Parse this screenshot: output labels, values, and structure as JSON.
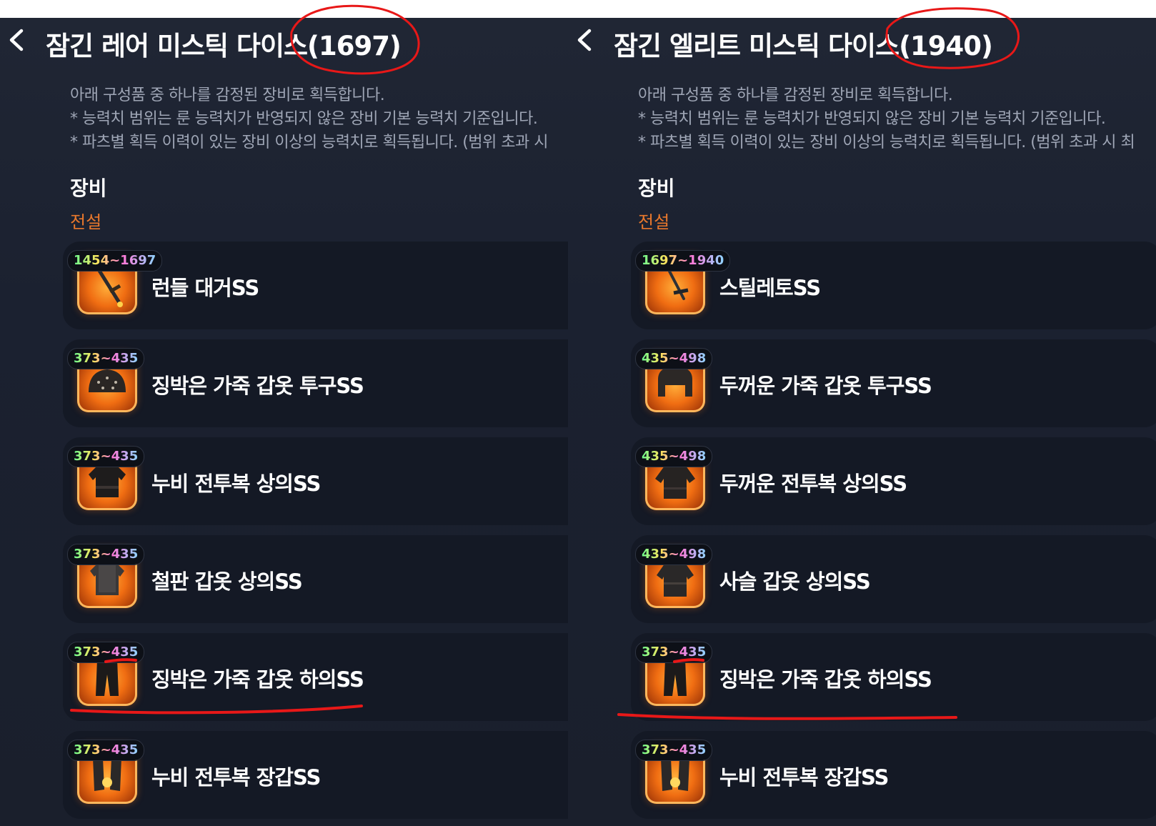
{
  "panels": [
    {
      "title": "잠긴 레어 미스틱 다이스(1697)",
      "description": [
        "아래 구성품 중 하나를 감정된 장비로 획득합니다.",
        "* 능력치 범위는 룬 능력치가 반영되지 않은 장비 기본 능력치 기준입니다.",
        "* 파츠별 획득 이력이 있는 장비 이상의 능력치로 획득됩니다. (범위 초과 시"
      ],
      "section": "장비",
      "tier": "전설",
      "items": [
        {
          "range": "1454~1697",
          "name": "런들 대거SS",
          "icon": "dagger-icon"
        },
        {
          "range": "373~435",
          "name": "징박은 가죽 갑옷 투구SS",
          "icon": "helmet-icon"
        },
        {
          "range": "373~435",
          "name": "누비 전투복 상의SS",
          "icon": "armor-top-icon"
        },
        {
          "range": "373~435",
          "name": "철판 갑옷 상의SS",
          "icon": "armor-top-icon"
        },
        {
          "range": "373~435",
          "name": "징박은 가죽 갑옷 하의SS",
          "icon": "pants-icon"
        },
        {
          "range": "373~435",
          "name": "누비 전투복 장갑SS",
          "icon": "gloves-icon"
        }
      ]
    },
    {
      "title": "잠긴 엘리트 미스틱 다이스(1940)",
      "description": [
        "아래 구성품 중 하나를 감정된 장비로 획득합니다.",
        "* 능력치 범위는 룬 능력치가 반영되지 않은 장비 기본 능력치 기준입니다.",
        "* 파츠별 획득 이력이 있는 장비 이상의 능력치로 획득됩니다. (범위 초과 시 최"
      ],
      "section": "장비",
      "tier": "전설",
      "items": [
        {
          "range": "1697~1940",
          "name": "스틸레토SS",
          "icon": "dagger-icon"
        },
        {
          "range": "435~498",
          "name": "두꺼운 가죽 갑옷 투구SS",
          "icon": "helmet-icon"
        },
        {
          "range": "435~498",
          "name": "두꺼운 전투복 상의SS",
          "icon": "armor-top-icon"
        },
        {
          "range": "435~498",
          "name": "사슬 갑옷 상의SS",
          "icon": "armor-top-icon"
        },
        {
          "range": "373~435",
          "name": "징박은 가죽 갑옷 하의SS",
          "icon": "pants-icon"
        },
        {
          "range": "373~435",
          "name": "누비 전투복 장갑SS",
          "icon": "gloves-icon"
        }
      ]
    }
  ],
  "colors": {
    "tier": "#e9782c",
    "annotation": "#e81818",
    "panel_bg": "#1c2230",
    "row_bg": "#141925"
  }
}
